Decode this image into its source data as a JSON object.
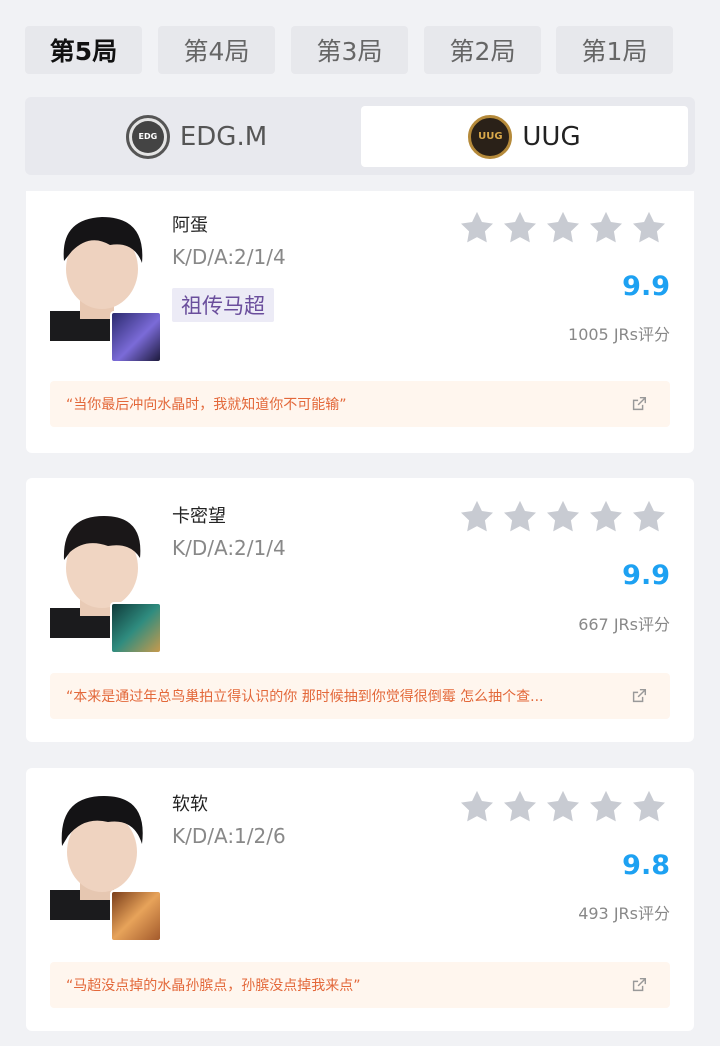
{
  "game_tabs": [
    "第5局",
    "第4局",
    "第3局",
    "第2局",
    "第1局"
  ],
  "active_tab": "第5局",
  "teams": [
    {
      "name": "EDG.M",
      "logo_text": "EDG",
      "active": false
    },
    {
      "name": "UUG",
      "logo_text": "UUG",
      "active": true
    }
  ],
  "players": [
    {
      "name": "阿蛋",
      "kda": "K/D/A:2/1/4",
      "tag": "祖传马超",
      "rating": "9.9",
      "stars": 5,
      "rating_count": "1005 JRs评分",
      "quote": "“当你最后冲向水晶时，我就知道你不可能输”"
    },
    {
      "name": "卡密望",
      "kda": "K/D/A:2/1/4",
      "tag": "",
      "rating": "9.9",
      "stars": 5,
      "rating_count": "667 JRs评分",
      "quote": "“本来是通过年总鸟巢拍立得认识的你 那时候抽到你觉得很倒霉 怎么抽个查..."
    },
    {
      "name": "软软",
      "kda": "K/D/A:1/2/6",
      "tag": "",
      "rating": "9.8",
      "stars": 5,
      "rating_count": "493 JRs评分",
      "quote": "“马超没点掉的水晶孙膑点，孙膑没点掉我来点”"
    }
  ],
  "colors": {
    "rating": "#1da1f2",
    "quote_text": "#e3683a",
    "quote_bg": "#fff6ee",
    "star": "#c8cbd2",
    "tag_text": "#6a4e9c"
  }
}
